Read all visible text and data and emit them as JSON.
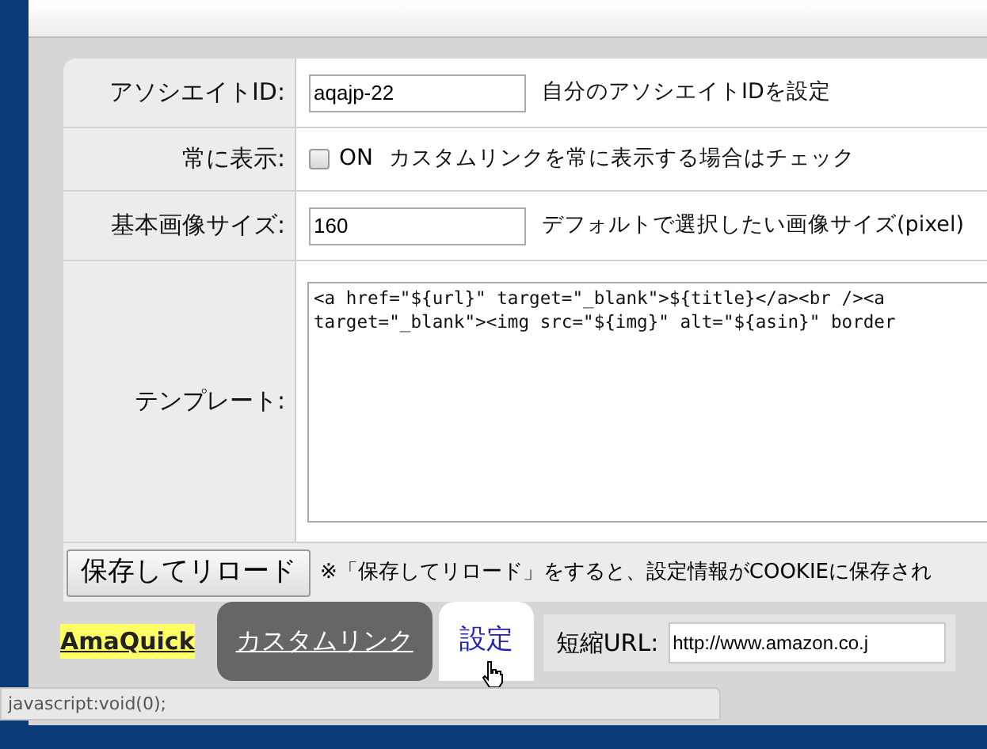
{
  "settings": {
    "rows": [
      {
        "kind": "text",
        "label": "アソシエイトID:",
        "value": "aqajp-22",
        "note": "自分のアソシエイトIDを設定"
      },
      {
        "kind": "checkbox",
        "label": "常に表示:",
        "checked": false,
        "option": "ON",
        "note": "カスタムリンクを常に表示する場合はチェック"
      },
      {
        "kind": "text",
        "label": "基本画像サイズ:",
        "value": "160",
        "note": "デフォルトで選択したい画像サイズ(pixel)"
      },
      {
        "kind": "textarea",
        "label": "テンプレート:",
        "lines": [
          "<a href=\"${url}\" target=\"_blank\">${title}</a><br /><a",
          "target=\"_blank\"><img src=\"${img}\" alt=\"${asin}\" border"
        ]
      }
    ],
    "save_button": "保存してリロード",
    "save_note": "※「保存してリロード」をすると、設定情報がCOOKIEに保存され"
  },
  "tabs": [
    {
      "label": "AmaQuick",
      "kind": "link",
      "selected": false
    },
    {
      "label": "カスタムリンク",
      "kind": "tab",
      "selected": false
    },
    {
      "label": "設定",
      "kind": "tab",
      "selected": true
    }
  ],
  "short_url": {
    "label": "短縮URL:",
    "value": "http://www.amazon.co.j"
  },
  "status_bar": "javascript:void(0);"
}
